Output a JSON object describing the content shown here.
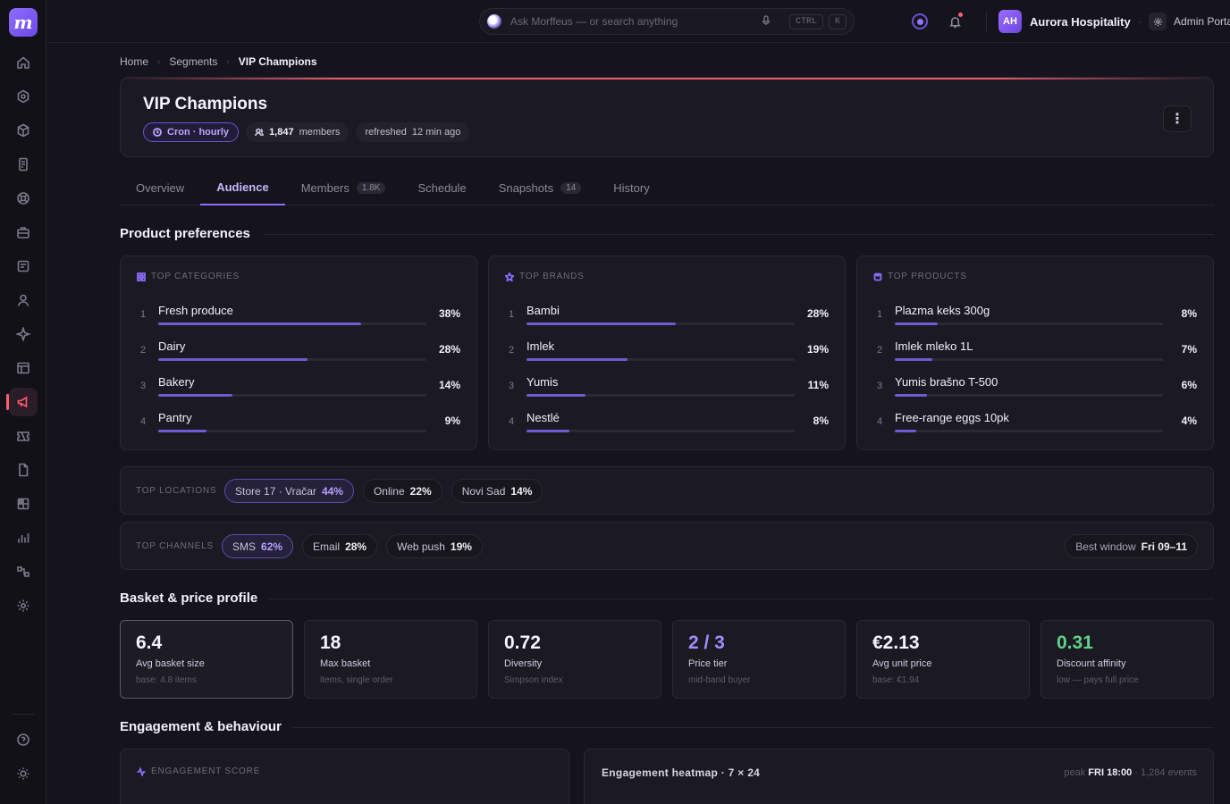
{
  "app": {
    "logo_letter": "m"
  },
  "topbar": {
    "search_placeholder": "Ask Morffeus — or search anything",
    "shortcut_key1": "CTRL",
    "shortcut_key2": "K",
    "org_initials": "AH",
    "org_name": "Aurora Hospitality",
    "admin_label": "Admin Portal"
  },
  "breadcrumb": [
    "Home",
    "Segments",
    "VIP Champions"
  ],
  "segment": {
    "title": "VIP Champions",
    "schedule_chip": "Cron · hourly",
    "members_count": "1,847",
    "members_label": "members",
    "refreshed_label": "refreshed",
    "refreshed_value": "12 min ago"
  },
  "tabs": [
    {
      "label": "Overview"
    },
    {
      "label": "Audience",
      "active": true
    },
    {
      "label": "Members",
      "count": "1.8K"
    },
    {
      "label": "Schedule"
    },
    {
      "label": "Snapshots",
      "count": "14"
    },
    {
      "label": "History"
    }
  ],
  "product_prefs": {
    "title": "Product preferences",
    "cards": [
      {
        "heading": "TOP CATEGORIES",
        "icon": "grid-icon",
        "items": [
          {
            "rank": "1",
            "name": "Fresh produce",
            "pct": "38%",
            "share": 0.38
          },
          {
            "rank": "2",
            "name": "Dairy",
            "pct": "28%",
            "share": 0.28
          },
          {
            "rank": "3",
            "name": "Bakery",
            "pct": "14%",
            "share": 0.14
          },
          {
            "rank": "4",
            "name": "Pantry",
            "pct": "9%",
            "share": 0.09
          }
        ]
      },
      {
        "heading": "TOP BRANDS",
        "icon": "star-icon",
        "items": [
          {
            "rank": "1",
            "name": "Bambi",
            "pct": "28%",
            "share": 0.28
          },
          {
            "rank": "2",
            "name": "Imlek",
            "pct": "19%",
            "share": 0.19
          },
          {
            "rank": "3",
            "name": "Yumis",
            "pct": "11%",
            "share": 0.11
          },
          {
            "rank": "4",
            "name": "Nestlé",
            "pct": "8%",
            "share": 0.08
          }
        ]
      },
      {
        "heading": "TOP PRODUCTS",
        "icon": "box-icon",
        "items": [
          {
            "rank": "1",
            "name": "Plazma keks 300g",
            "pct": "8%",
            "share": 0.08
          },
          {
            "rank": "2",
            "name": "Imlek mleko 1L",
            "pct": "7%",
            "share": 0.07
          },
          {
            "rank": "3",
            "name": "Yumis brašno T-500",
            "pct": "6%",
            "share": 0.06
          },
          {
            "rank": "4",
            "name": "Free-range eggs 10pk",
            "pct": "4%",
            "share": 0.04
          }
        ]
      }
    ]
  },
  "locations": {
    "label": "TOP LOCATIONS",
    "items": [
      {
        "name": "Store 17 · Vračar",
        "pct": "44%",
        "highlight": true
      },
      {
        "name": "Online",
        "pct": "22%"
      },
      {
        "name": "Novi Sad",
        "pct": "14%"
      }
    ]
  },
  "channels": {
    "label": "TOP CHANNELS",
    "items": [
      {
        "name": "SMS",
        "pct": "62%",
        "highlight": true
      },
      {
        "name": "Email",
        "pct": "28%"
      },
      {
        "name": "Web push",
        "pct": "19%"
      }
    ],
    "best_window_label": "Best window",
    "best_window_value": "Fri 09–11"
  },
  "basket": {
    "title": "Basket & price profile",
    "kpis": [
      {
        "value": "6.4",
        "label": "Avg basket size",
        "sub": "base: 4.8 items",
        "color": "#f5f3fb",
        "selected": true
      },
      {
        "value": "18",
        "label": "Max basket",
        "sub": "items, single order",
        "color": "#f5f3fb"
      },
      {
        "value": "0.72",
        "label": "Diversity",
        "sub": "Simpson index",
        "color": "#f5f3fb"
      },
      {
        "value": "2 / 3",
        "label": "Price tier",
        "sub": "mid-band buyer",
        "color": "#a48cff"
      },
      {
        "value": "€2.13",
        "label": "Avg unit price",
        "sub": "base: €1.94",
        "color": "#f5f3fb"
      },
      {
        "value": "0.31",
        "label": "Discount affinity",
        "sub": "low — pays full price",
        "color": "#5fd38a"
      }
    ]
  },
  "engagement": {
    "title": "Engagement & behaviour",
    "score_heading": "ENGAGEMENT SCORE",
    "heatmap_title": "Engagement heatmap · 7 × 24",
    "heatmap_peak_label": "peak",
    "heatmap_peak_value": "FRI 18:00",
    "heatmap_events": "· 1,284 events"
  }
}
